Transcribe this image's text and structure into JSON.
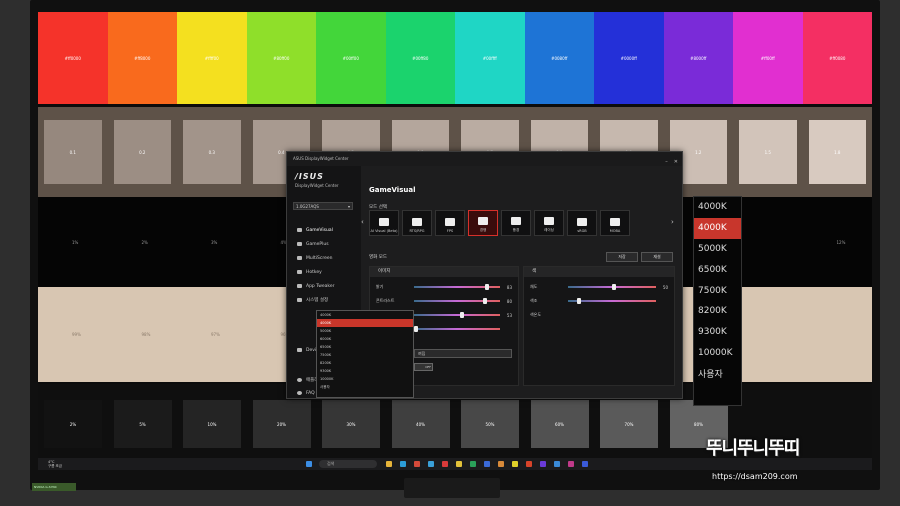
{
  "colors": {
    "swatches": [
      "#f5332a",
      "#f96a1d",
      "#f4e01f",
      "#8fdf2a",
      "#43d63a",
      "#1bd36d",
      "#1fd6c5",
      "#1e74d6",
      "#2430d8",
      "#7a2bd8",
      "#e12fd0",
      "#f42f63"
    ],
    "accent": "#c9362a"
  },
  "test_pattern": {
    "swatch_labels": [
      "#ff0000",
      "#ff8000",
      "#ffff00",
      "#80ff00",
      "#00ff00",
      "#00ff80",
      "#00ffff",
      "#0080ff",
      "#0000ff",
      "#8000ff",
      "#ff00ff",
      "#ff0080"
    ],
    "gray_tiles": [
      "0.1",
      "0.2",
      "0.3",
      "0.4",
      "0.5",
      "0.6",
      "0.7",
      "0.8",
      "1.0",
      "1.2",
      "1.5",
      "1.8"
    ],
    "low_pcts": [
      "1%",
      "2%",
      "3%",
      "4%",
      "",
      "",
      "",
      "",
      "",
      "",
      "",
      "12%"
    ],
    "high_pcts": [
      "99%",
      "98%",
      "97%",
      "96%"
    ],
    "bottom_pcts": [
      "2%",
      "5%",
      "10%",
      "20%",
      "30%",
      "40%",
      "50%",
      "60%",
      "70%",
      "80%"
    ]
  },
  "app": {
    "window_title": "ASUS DisplayWidget Center",
    "logo": "/ISUS",
    "logo_sub": "DisplayWidget Center",
    "model": "1.0G27AQS",
    "sidebar": [
      {
        "label": "GameVisual",
        "active": true
      },
      {
        "label": "GamePlus",
        "active": false
      },
      {
        "label": "MultiScreen",
        "active": false
      },
      {
        "label": "Hotkey",
        "active": false
      },
      {
        "label": "App Tweaker",
        "active": false
      },
      {
        "label": "시스템 설정",
        "active": false
      }
    ],
    "device_info": "Device Info",
    "app_settings": "애플리케이션 설정",
    "faq": "FAQ / User manual",
    "heading": "GameVisual",
    "mode_select": "모드 선택",
    "modes": [
      "AI Visual (Beta)",
      "RTS/RPG",
      "FPS",
      "경쟁",
      "풍경",
      "레이싱",
      "sRGB",
      "MOBA"
    ],
    "mode_active_index": 3,
    "image_mode": "영화 모드",
    "save_btn": "저장",
    "reset_btn": "재설",
    "panel_image": "이미지",
    "panel_color": "색",
    "sliders_left": [
      {
        "label": "밝기",
        "value": "83",
        "pos": 0.83
      },
      {
        "label": "콘트라스트",
        "value": "80",
        "pos": 0.8
      },
      {
        "label": "가변 OD",
        "value": "53",
        "pos": 0.53
      },
      {
        "label": "블루 라이트 필터",
        "value": "",
        "pos": 0.0
      }
    ],
    "shadow_boost_label": "Shadow Boost",
    "shadow_boost_value": "꺼짐",
    "ascr_label": "ASCR",
    "ascr_value": "OFF",
    "sliders_right": [
      {
        "label": "채도",
        "value": "50",
        "pos": 0.5
      },
      {
        "label": "색조",
        "value": "",
        "pos": 0.1
      }
    ],
    "color_temp_label": "색온도",
    "dropdown_items": [
      "4000K",
      "4000K",
      "5000K",
      "6000K",
      "6500K",
      "7500K",
      "8200K",
      "9300K",
      "10000K",
      "사용자"
    ],
    "dropdown_selected": 1
  },
  "big_list": {
    "items": [
      "4000K",
      "4000K",
      "5000K",
      "6500K",
      "7500K",
      "8200K",
      "9300K",
      "10000K",
      "사용자"
    ],
    "selected": 1
  },
  "taskbar": {
    "weather_temp": "4°C",
    "weather_desc": "구름 조금",
    "search_placeholder": "검색"
  },
  "sticker": "NVIDIA G-SYNC",
  "watermark": {
    "title": "뚜니뚜니뚜띠",
    "url": "https://dsam209.com"
  }
}
